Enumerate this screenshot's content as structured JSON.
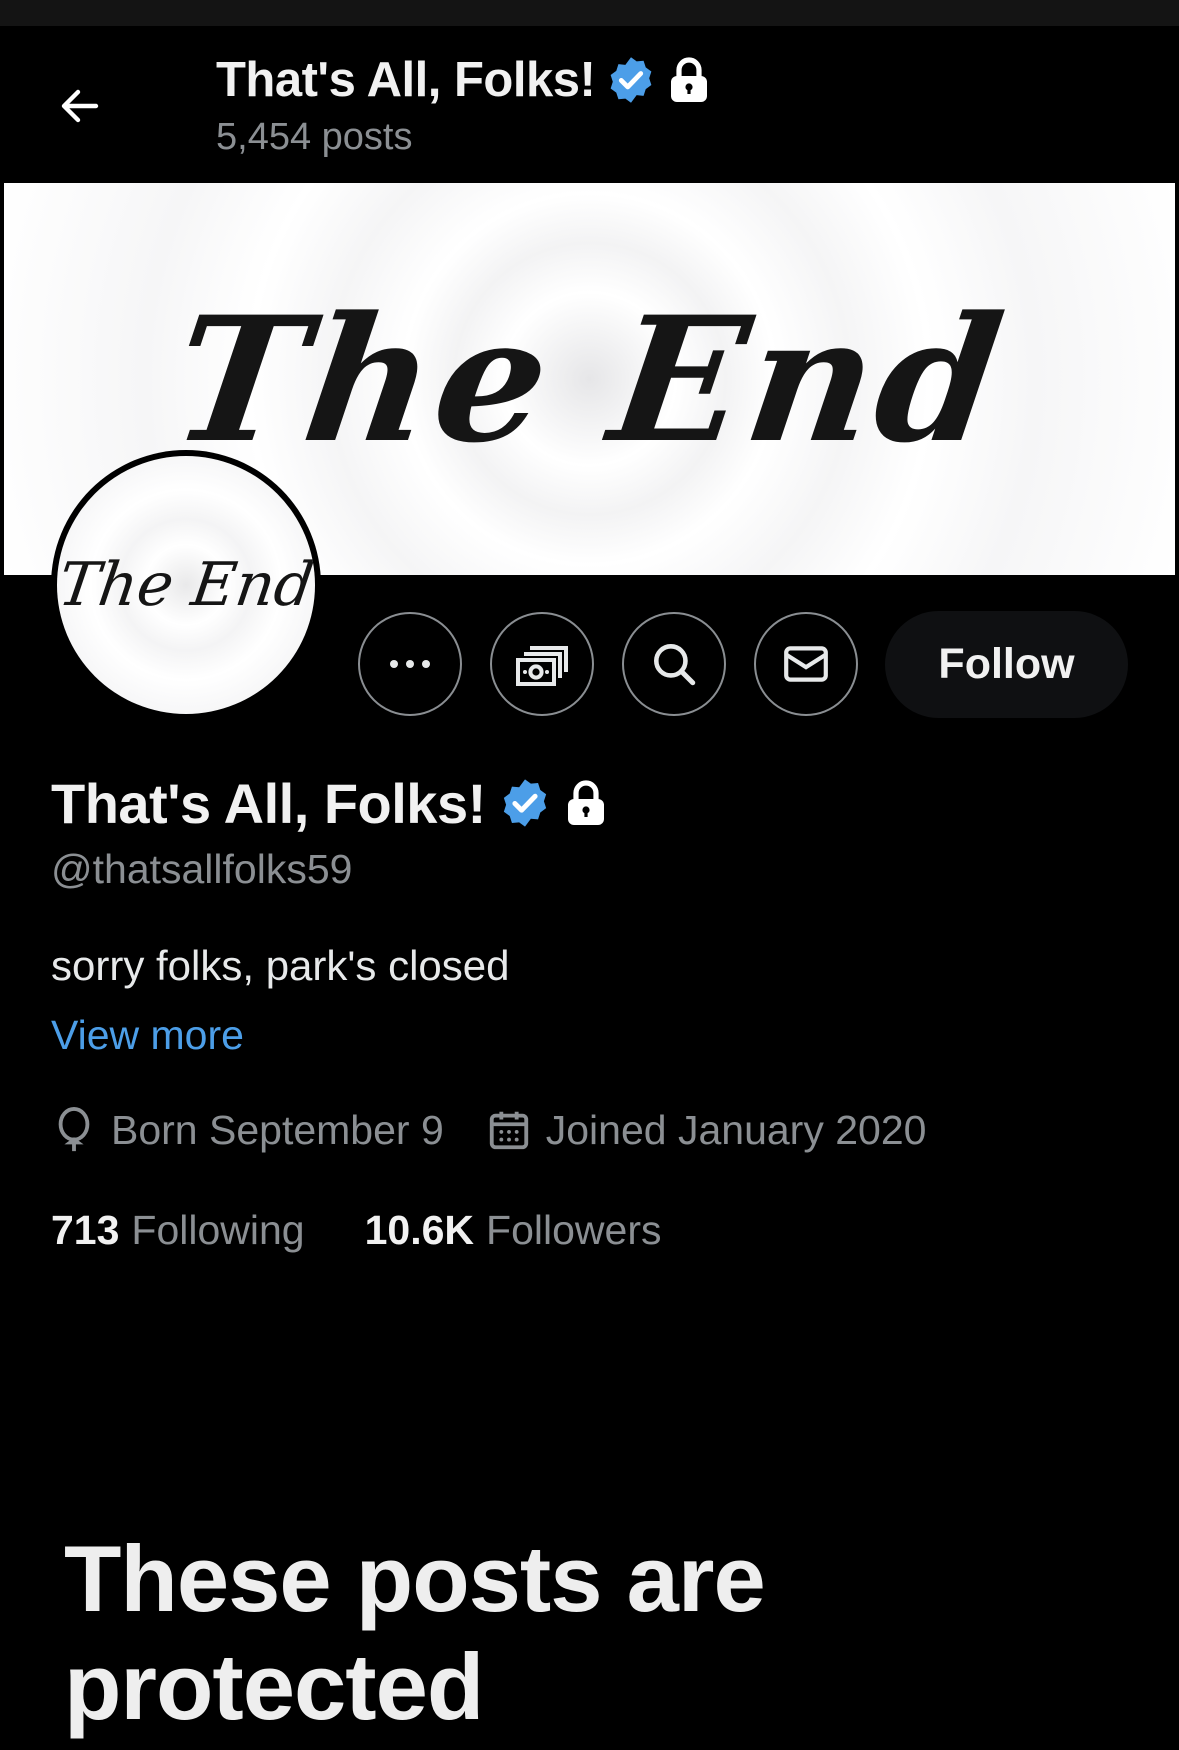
{
  "header": {
    "title": "That's All, Folks!",
    "post_count": "5,454 posts"
  },
  "banner": {
    "text": "The End"
  },
  "avatar": {
    "text": "The End"
  },
  "actions": {
    "more_icon": "more-horizontal-icon",
    "subscribe_icon": "money-icon",
    "search_icon": "search-icon",
    "message_icon": "envelope-icon",
    "follow_label": "Follow"
  },
  "profile": {
    "name": "That's All, Folks!",
    "handle": "@thatsallfolks59",
    "bio": "sorry folks, park's closed",
    "view_more": "View more",
    "birthday": "Born September 9",
    "joined": "Joined January 2020"
  },
  "stats": {
    "following_count": "713",
    "following_label": "Following",
    "followers_count": "10.6K",
    "followers_label": "Followers"
  },
  "protected": {
    "message": "These posts are protected"
  },
  "colors": {
    "background": "#000000",
    "verified": "#4c9ee8",
    "link": "#4c9ee8",
    "secondary_text": "#8b8f93"
  }
}
